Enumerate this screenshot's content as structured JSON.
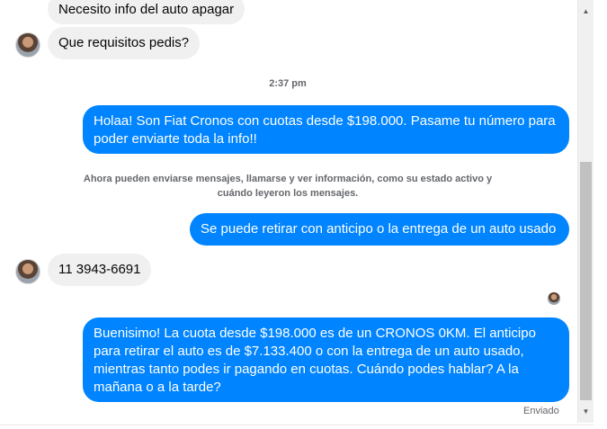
{
  "messages": {
    "m1": "Necesito info del auto apagar",
    "m2": "Que requisitos pedis?",
    "timestamp": "2:37 pm",
    "m3": "Holaa! Son Fiat Cronos con cuotas desde $198.000. Pasame tu número para poder enviarte toda la info!!",
    "notice": "Ahora pueden enviarse mensajes, llamarse y ver información, como su estado activo y cuándo leyeron los mensajes.",
    "m4": "Se puede retirar con anticipo  o la entrega de un auto usado",
    "m5": "11 3943-6691",
    "m6": "Buenisimo! La cuota desde $198.000 es de un CRONOS 0KM. El anticipo para retirar el auto es de $7.133.400 o con la entrega de un auto usado, mientras tanto podes ir pagando en cuotas. Cuándo podes hablar? A la mañana o a la tarde?",
    "status": "Enviado"
  },
  "colors": {
    "outgoing_bubble": "#0084ff",
    "incoming_bubble": "#f0f0f0"
  },
  "icons": {
    "scroll_up": "triangle-up",
    "scroll_down": "triangle-down"
  }
}
